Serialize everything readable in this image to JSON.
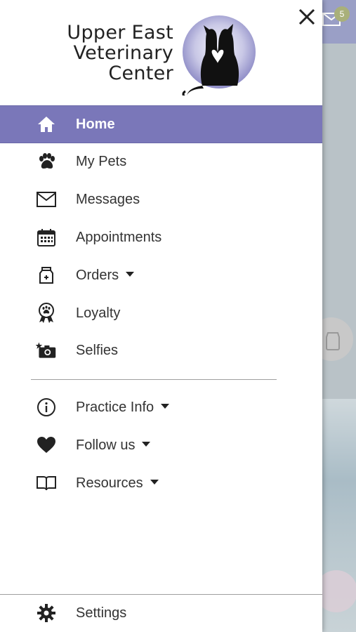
{
  "app": {
    "logo_lines": [
      "Upper East",
      "Veterinary",
      "Center"
    ]
  },
  "drawer": {
    "close_icon": "close-icon",
    "main_items": [
      {
        "label": "Home",
        "icon": "home-icon",
        "active": true
      },
      {
        "label": "My Pets",
        "icon": "paw-icon"
      },
      {
        "label": "Messages",
        "icon": "envelope-icon"
      },
      {
        "label": "Appointments",
        "icon": "calendar-icon"
      },
      {
        "label": "Orders",
        "icon": "food-bag-icon",
        "has_dropdown": true
      },
      {
        "label": "Loyalty",
        "icon": "award-ribbon-icon"
      },
      {
        "label": "Selfies",
        "icon": "camera-icon"
      }
    ],
    "secondary_items": [
      {
        "label": "Practice Info",
        "icon": "info-icon",
        "has_dropdown": true
      },
      {
        "label": "Follow us",
        "icon": "heart-icon",
        "has_dropdown": true
      },
      {
        "label": "Resources",
        "icon": "book-icon",
        "has_dropdown": true
      }
    ],
    "footer_item": {
      "label": "Settings",
      "icon": "gear-icon"
    }
  },
  "background_app": {
    "message_badge": "5"
  },
  "colors": {
    "active_bg": "#7a77b9",
    "header_accent": "#9a9fc6",
    "text": "#333333",
    "divider": "#9e9e9e"
  }
}
